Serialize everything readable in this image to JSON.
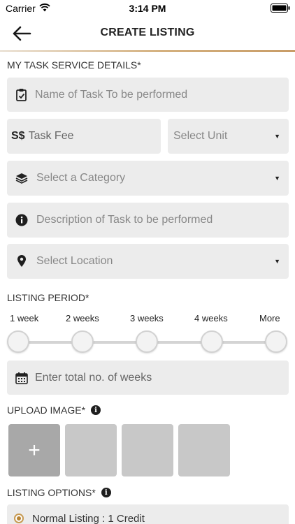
{
  "status_bar": {
    "carrier": "Carrier",
    "time": "3:14 PM"
  },
  "nav": {
    "title": "CREATE LISTING"
  },
  "task_details": {
    "label": "MY TASK SERVICE DETAILS*",
    "name_placeholder": "Name of Task To be performed",
    "currency_symbol": "S$",
    "fee_placeholder": "Task Fee",
    "unit_placeholder": "Select Unit",
    "category_placeholder": "Select a Category",
    "description_placeholder": "Description of Task to be performed",
    "location_placeholder": "Select Location"
  },
  "listing_period": {
    "label": "LISTING PERIOD*",
    "options": [
      "1 week",
      "2 weeks",
      "3 weeks",
      "4 weeks",
      "More"
    ],
    "weeks_placeholder": "Enter total no. of weeks"
  },
  "upload": {
    "label": "UPLOAD IMAGE*",
    "add_symbol": "+"
  },
  "listing_options": {
    "label": "LISTING OPTIONS*",
    "normal_option": "Normal Listing : 1 Credit"
  },
  "colors": {
    "accent": "#c89a5a",
    "field_bg": "#ececec",
    "image_slot": "#c8c8c8",
    "add_slot": "#a8a8a8"
  }
}
